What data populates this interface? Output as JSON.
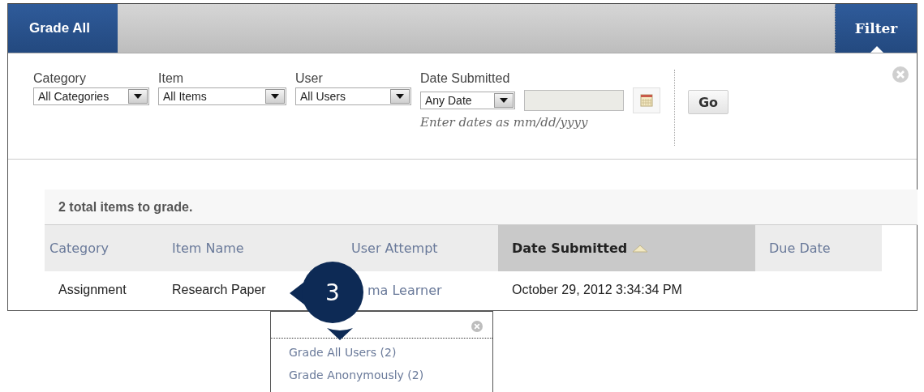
{
  "page_title": "Grade All",
  "filter_tab": {
    "label": "Filter",
    "expanded": true
  },
  "filters": [
    {
      "kind": "select",
      "label": "Category",
      "value": "All Categories"
    },
    {
      "kind": "select",
      "label": "Item",
      "value": "All Items"
    },
    {
      "kind": "select",
      "label": "User",
      "value": "All Users"
    },
    {
      "kind": "date",
      "label": "Date Submitted",
      "value": "Any Date",
      "hint": "Enter dates as mm/dd/yyyy"
    }
  ],
  "go_button": "Go",
  "summary": "2 total items to grade.",
  "table": {
    "columns": [
      {
        "label": "Category",
        "sorted": false
      },
      {
        "label": "Item Name",
        "sorted": false
      },
      {
        "label": "User Attempt",
        "sorted": false
      },
      {
        "label": "Date Submitted",
        "sorted": true
      },
      {
        "label": "Due Date",
        "sorted": false
      }
    ],
    "rows": [
      {
        "cells": [
          "Assignment",
          "Research Paper",
          "ma Learner",
          "October 29, 2012 3:34:34 PM"
        ]
      }
    ]
  },
  "callout": {
    "number": "3"
  },
  "menu": {
    "items": [
      "Grade All Users (2)",
      "Grade Anonymously (2)"
    ]
  }
}
